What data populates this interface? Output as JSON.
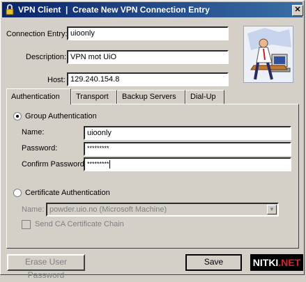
{
  "window": {
    "title": "VPN Client  |  Create New VPN Connection Entry",
    "close_label": "✕"
  },
  "entry": {
    "connection_label": "Connection Entry:",
    "connection_value": "uioonly",
    "description_label": "Description:",
    "description_value": "VPN mot UiO",
    "host_label": "Host:",
    "host_value": "129.240.154.8"
  },
  "tabs": [
    {
      "label": "Authentication"
    },
    {
      "label": "Transport"
    },
    {
      "label": "Backup Servers"
    },
    {
      "label": "Dial-Up"
    }
  ],
  "group_auth": {
    "radio_label": "Group Authentication",
    "name_label": "Name:",
    "name_value": "uioonly",
    "password_label": "Password:",
    "password_value": "*********",
    "confirm_label": "Confirm Password:",
    "confirm_value": "*********"
  },
  "cert_auth": {
    "radio_label": "Certificate Authentication",
    "name_label": "Name:",
    "name_value": "powder.uio.no (Microsoft Machine)",
    "send_chain_label": "Send CA Certificate Chain"
  },
  "buttons": {
    "erase_password": "Erase User Password",
    "save": "Save"
  },
  "watermark": {
    "text_main": "NITKI",
    "text_accent": ".NET"
  }
}
